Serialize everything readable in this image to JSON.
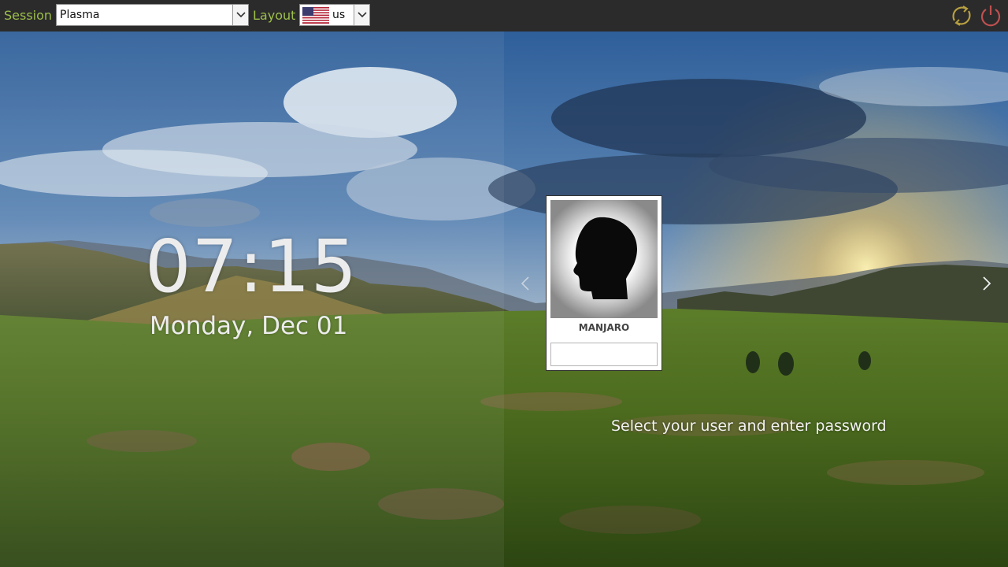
{
  "topbar": {
    "session_label": "Session",
    "session_value": "Plasma",
    "layout_label": "Layout",
    "layout_value": "us",
    "layout_flag_icon": "us-flag-icon",
    "reboot_icon": "restart-icon",
    "shutdown_icon": "power-icon"
  },
  "clock": {
    "time": "07:15",
    "date": "Monday, Dec 01"
  },
  "user_card": {
    "username": "MANJARO",
    "avatar_icon": "user-silhouette-icon",
    "password_value": ""
  },
  "navigation": {
    "prev_icon": "chevron-left-icon",
    "next_icon": "chevron-right-icon"
  },
  "prompt": "Select your user and enter password",
  "colors": {
    "topbar_bg": "#2b2b2b",
    "label_accent": "#9dbf4a",
    "restart_icon": "#b8a040",
    "power_icon": "#c05050"
  }
}
